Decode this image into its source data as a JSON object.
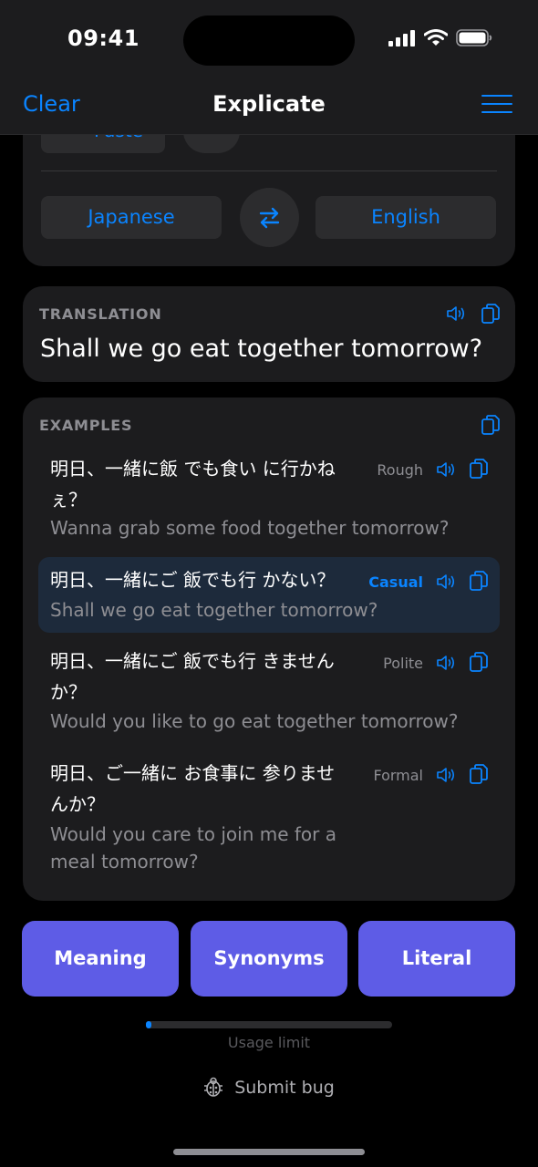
{
  "status": {
    "time": "09:41"
  },
  "nav": {
    "left": "Clear",
    "title": "Explicate"
  },
  "input": {
    "paste_label": "Paste",
    "source_lang": "Japanese",
    "target_lang": "English"
  },
  "translation": {
    "label": "TRANSLATION",
    "text": "Shall we go eat together tomorrow?"
  },
  "examples": {
    "label": "EXAMPLES",
    "items": [
      {
        "jp": "明日、一緒に飯 でも食い に行かねぇ？",
        "en": "Wanna grab some food together tomorrow?",
        "tone": "Rough",
        "selected": false
      },
      {
        "jp": "明日、一緒にご 飯でも行 かない？",
        "en": "Shall we go eat together tomorrow?",
        "tone": "Casual",
        "selected": true
      },
      {
        "jp": "明日、一緒にご 飯でも行 きませんか？",
        "en": "Would you like to go eat together tomorrow?",
        "tone": "Polite",
        "selected": false
      },
      {
        "jp": "明日、ご一緒に お食事に 参りませんか？",
        "en": "Would you care to join me for a meal tomorrow?",
        "tone": "Formal",
        "selected": false
      }
    ]
  },
  "actions": {
    "meaning": "Meaning",
    "synonyms": "Synonyms",
    "literal": "Literal"
  },
  "usage": {
    "label": "Usage limit",
    "fraction": 0.02
  },
  "footer": {
    "submit_bug": "Submit bug"
  },
  "colors": {
    "accent": "#0a84ff",
    "action": "#5e5ce6",
    "card": "#1c1c1e"
  }
}
